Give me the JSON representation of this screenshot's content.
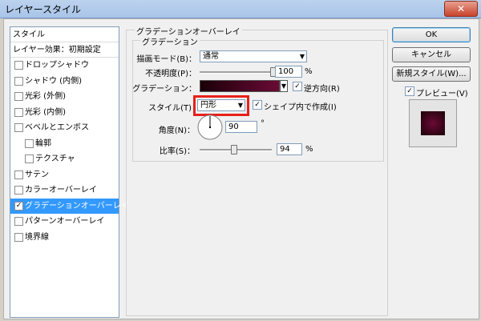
{
  "window": {
    "title": "レイヤースタイル",
    "close_label": "✕"
  },
  "style_list": {
    "header": "スタイル",
    "blend_default": "レイヤー効果：初期設定",
    "items": [
      {
        "label": "ドロップシャドウ",
        "checked": false,
        "indent": false
      },
      {
        "label": "シャドウ (内側)",
        "checked": false,
        "indent": false
      },
      {
        "label": "光彩 (外側)",
        "checked": false,
        "indent": false
      },
      {
        "label": "光彩 (内側)",
        "checked": false,
        "indent": false
      },
      {
        "label": "ベベルとエンボス",
        "checked": false,
        "indent": false
      },
      {
        "label": "輪郭",
        "checked": false,
        "indent": true
      },
      {
        "label": "テクスチャ",
        "checked": false,
        "indent": true
      },
      {
        "label": "サテン",
        "checked": false,
        "indent": false
      },
      {
        "label": "カラーオーバーレイ",
        "checked": false,
        "indent": false
      },
      {
        "label": "グラデーションオーバーレイ",
        "checked": true,
        "indent": false,
        "selected": true
      },
      {
        "label": "パターンオーバーレイ",
        "checked": false,
        "indent": false
      },
      {
        "label": "境界線",
        "checked": false,
        "indent": false
      }
    ]
  },
  "panel": {
    "outer_legend": "グラデーションオーバーレイ",
    "inner_legend": "グラデーション",
    "blend_mode_label": "描画モード(B)：",
    "blend_mode_value": "通常",
    "opacity_label": "不透明度(P)：",
    "opacity_value": "100",
    "opacity_unit": "%",
    "opacity_fraction": 1.0,
    "gradient_label": "グラデーション：",
    "reverse_label": "逆方向(R)",
    "reverse_checked": true,
    "style_label": "スタイル(T)",
    "style_value": "円形",
    "align_label": "シェイプ内で作成(I)",
    "align_checked": true,
    "angle_label": "角度(N)：",
    "angle_value": "90",
    "angle_unit": "°",
    "scale_label": "比率(S)：",
    "scale_value": "94",
    "scale_unit": "%",
    "scale_fraction": 0.47
  },
  "buttons": {
    "ok": "OK",
    "cancel": "キャンセル",
    "new_style": "新規スタイル(W)...",
    "preview_label": "プレビュー(V)",
    "preview_checked": true
  },
  "colors": {
    "highlight_box": "#e8201a",
    "gradient_dark": "#1a0008",
    "gradient_light": "#6b0a35",
    "selection": "#3399ff"
  }
}
